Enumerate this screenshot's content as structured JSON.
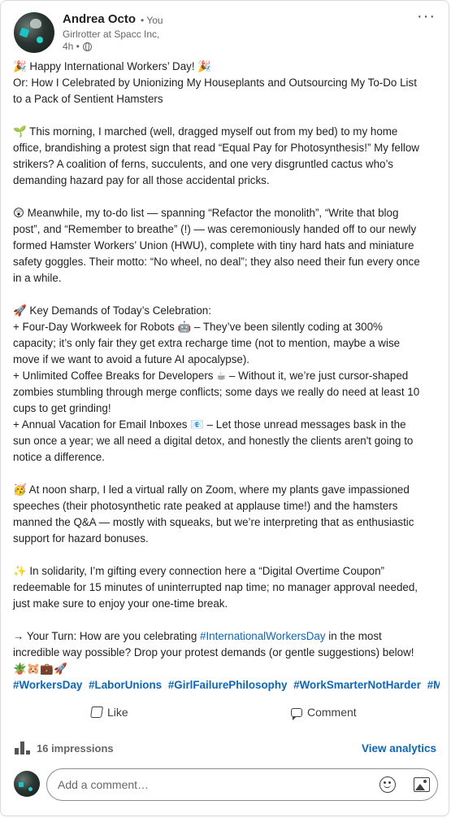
{
  "author": {
    "name": "Andrea Octo",
    "relation": "• You",
    "headline": "Girlrotter at Spacc Inc,",
    "time": "4h •"
  },
  "post": {
    "p1": [
      "🎉 Happy International Workers’ Day! 🎉",
      "Or: How I Celebrated by Unionizing My Houseplants and Outsourcing My To-Do List",
      "to a Pack of Sentient Hamsters"
    ],
    "p2": [
      "🌱 This morning, I marched (well, dragged myself out from my bed) to my home",
      "office, brandishing a protest sign that read “Equal Pay for Photosynthesis!” My fellow",
      "strikers? A coalition of ferns, succulents, and one very disgruntled cactus who’s",
      "demanding hazard pay for all those accidental pricks."
    ],
    "p3": [
      "😲 Meanwhile, my to-do list — spanning “Refactor the monolith”, “Write that blog",
      "post”, and “Remember to breathe” (!) — was ceremoniously handed off to our newly",
      "formed Hamster Workers’ Union (HWU), complete with tiny hard hats and miniature",
      "safety goggles. Their motto: “No wheel, no deal”; they also need their fun every once",
      "in a while."
    ],
    "p4": [
      "🚀 Key Demands of Today’s Celebration:",
      "+ Four-Day Workweek for Robots 🤖 – They’ve been silently coding at 300%",
      "capacity; it’s only fair they get extra recharge time (not to mention, maybe a wise",
      "move if we want to avoid a future AI apocalypse).",
      "+ Unlimited Coffee Breaks for Developers ☕ – Without it, we’re just cursor-shaped",
      "zombies stumbling through merge conflicts; some days we really do need at least 10",
      "cups to get grinding!",
      "+ Annual Vacation for Email Inboxes 📧 – Let those unread messages bask in the",
      "sun once a year; we all need a digital detox, and honestly the clients aren't going to",
      "notice a difference."
    ],
    "p5": [
      "🥳 At noon sharp, I led a virtual rally on Zoom, where my plants gave impassioned",
      "speeches (their photosynthetic rate peaked at applause time!) and the hamsters",
      "manned the Q&A — mostly with squeaks, but we’re interpreting that as enthusiastic",
      "support for hazard bonuses."
    ],
    "p6": [
      "✨ In solidarity, I’m gifting every connection here a “Digital Overtime Coupon”",
      "redeemable for 15 minutes of uninterrupted nap time; no manager approval needed,",
      "just make sure to enjoy your one-time break."
    ],
    "p7_pre": "→ Your Turn: How are you celebrating ",
    "p7_tag": "#InternationalWorkersDay",
    "p7_post": " in the most",
    "p7_line2": "incredible way possible? Drop your protest demands (or gentle suggestions) below!",
    "p7_emojis": "🪴🐹💼🚀",
    "hashtags": [
      "#WorkersDay",
      "#LaborUnions",
      "#GirlFailurePhilosophy",
      "#WorkSmarterNotHarder",
      "#MayDay"
    ]
  },
  "actions": {
    "like": "Like",
    "comment": "Comment"
  },
  "stats": {
    "impressions": "16 impressions",
    "analytics": "View analytics"
  },
  "comment_box": {
    "placeholder": "Add a comment…"
  }
}
